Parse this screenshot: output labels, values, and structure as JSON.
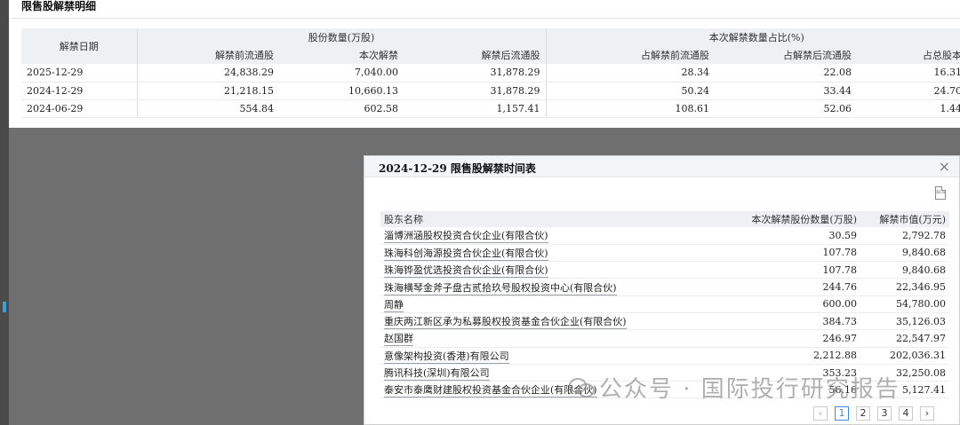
{
  "top": {
    "title": "限售股解禁明细",
    "group_headers": {
      "date": "解禁日期",
      "shares": "股份数量(万股)",
      "ratio": "本次解禁数量占比(%)"
    },
    "sub_headers": [
      "解禁前流通股",
      "本次解禁",
      "解禁后流通股",
      "占解禁前流通股",
      "占解禁后流通股",
      "占总股本"
    ],
    "rows": [
      [
        "2025-12-29",
        "24,838.29",
        "7,040.00",
        "31,878.29",
        "28.34",
        "22.08",
        "16.31"
      ],
      [
        "2024-12-29",
        "21,218.15",
        "10,660.13",
        "31,878.29",
        "50.24",
        "33.44",
        "24.70"
      ],
      [
        "2024-06-29",
        "554.84",
        "602.58",
        "1,157.41",
        "108.61",
        "52.06",
        "1.44"
      ]
    ]
  },
  "dialog": {
    "title": "2024-12-29 限售股解禁时间表",
    "close": "×",
    "xls_icon_text": "XLS",
    "headers": {
      "name": "股东名称",
      "qty": "本次解禁股份数量(万股)",
      "value": "解禁市值(万元)"
    },
    "rows": [
      [
        "淄博洲涵股权投资合伙企业(有限合伙)",
        "30.59",
        "2,792.78"
      ],
      [
        "珠海科创海源投资合伙企业(有限合伙)",
        "107.78",
        "9,840.68"
      ],
      [
        "珠海铧盈优选投资合伙企业(有限合伙)",
        "107.78",
        "9,840.68"
      ],
      [
        "珠海横琴金斧子盘古贰拾玖号股权投资中心(有限合伙)",
        "244.76",
        "22,346.95"
      ],
      [
        "周静",
        "600.00",
        "54,780.00"
      ],
      [
        "重庆两江新区承为私募股权投资基金合伙企业(有限合伙)",
        "384.73",
        "35,126.03"
      ],
      [
        "赵国群",
        "246.97",
        "22,547.97"
      ],
      [
        "意像架构投资(香港)有限公司",
        "2,212.88",
        "202,036.31"
      ],
      [
        "腾讯科技(深圳)有限公司",
        "353.23",
        "32,250.08"
      ],
      [
        "泰安市泰鹰财建股权投资基金合伙企业(有限合伙)",
        "56.16",
        "5,127.41"
      ]
    ],
    "pager": {
      "prev": "‹",
      "pages": [
        "1",
        "2",
        "3",
        "4"
      ],
      "next": "›",
      "active": "1"
    }
  },
  "watermark": {
    "text": "公众号 · 国际投行研究报告"
  },
  "colors": {
    "accent": "#3a8ee6",
    "header_bg": "#eef0f3",
    "backdrop": "#6f6f6f"
  }
}
